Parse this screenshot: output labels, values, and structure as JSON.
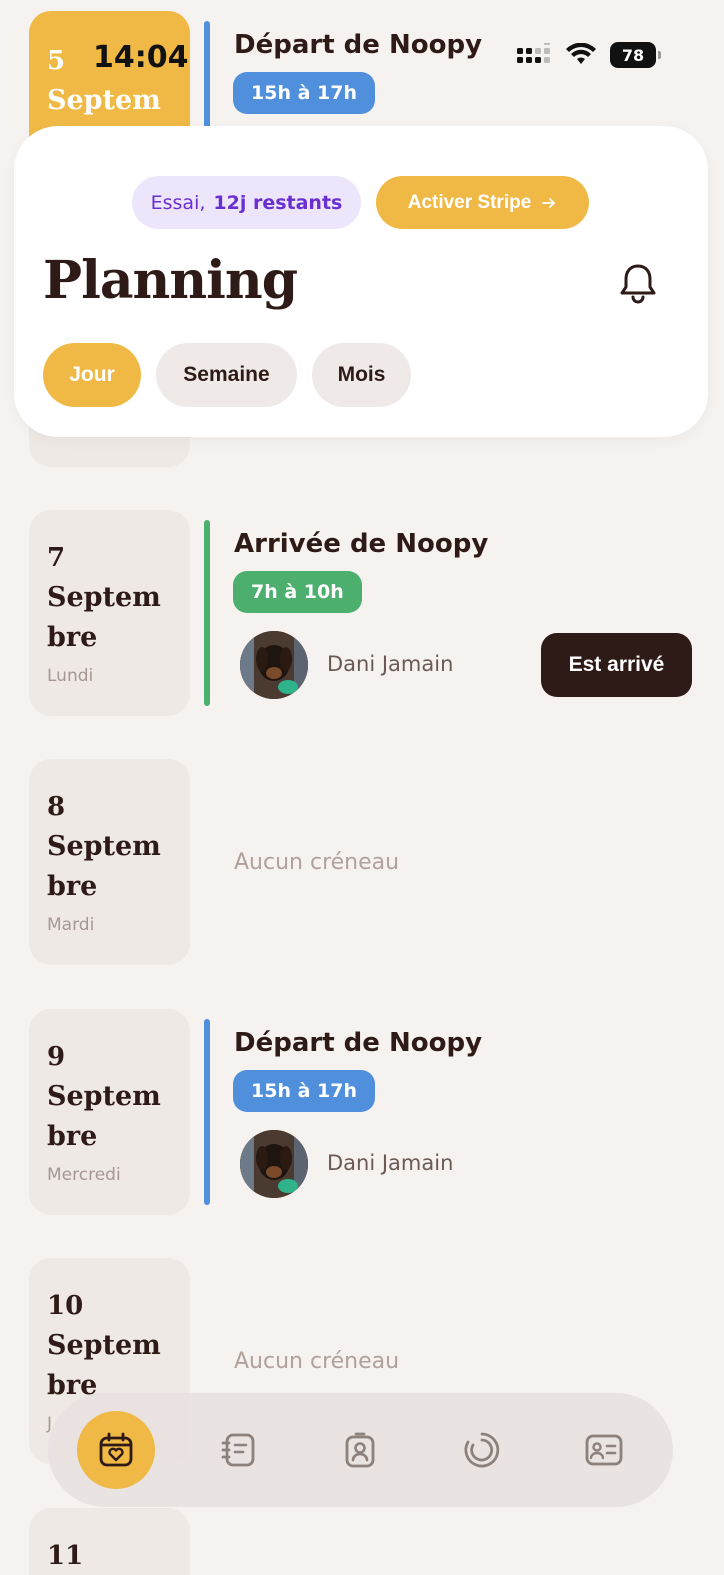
{
  "status": {
    "time": "14:04",
    "battery": "78"
  },
  "header": {
    "trial_label": "Essai,",
    "trial_days": "12j restants",
    "stripe_button": "Activer Stripe",
    "title": "Planning",
    "segments": {
      "day": "Jour",
      "week": "Semaine",
      "month": "Mois"
    }
  },
  "days": [
    {
      "num": "5",
      "month": "Septem",
      "event_title": "Départ de Noopy",
      "time": "15h à 17h"
    },
    {
      "num": "7",
      "month_a": "Septem",
      "month_b": "bre",
      "weekday": "Lundi",
      "event_title": "Arrivée de Noopy",
      "time": "7h à 10h",
      "person": "Dani Jamain",
      "action": "Est arrivé"
    },
    {
      "num": "8",
      "month_a": "Septem",
      "month_b": "bre",
      "weekday": "Mardi",
      "empty": "Aucun créneau"
    },
    {
      "num": "9",
      "month_a": "Septem",
      "month_b": "bre",
      "weekday": "Mercredi",
      "event_title": "Départ de Noopy",
      "time": "15h à 17h",
      "person": "Dani Jamain"
    },
    {
      "num": "10",
      "month_a": "Septem",
      "month_b": "bre",
      "weekday": "J",
      "empty": "Aucun créneau"
    },
    {
      "num": "11"
    }
  ],
  "nav": [
    "calendar-heart-icon",
    "notebook-icon",
    "badge-person-icon",
    "progress-ring-icon",
    "id-card-icon"
  ],
  "colors": {
    "accent": "#f0b945",
    "dark": "#2e1b17",
    "blue": "#4f8fdc",
    "green": "#4caf6e",
    "purple": "#6a2fd1"
  }
}
